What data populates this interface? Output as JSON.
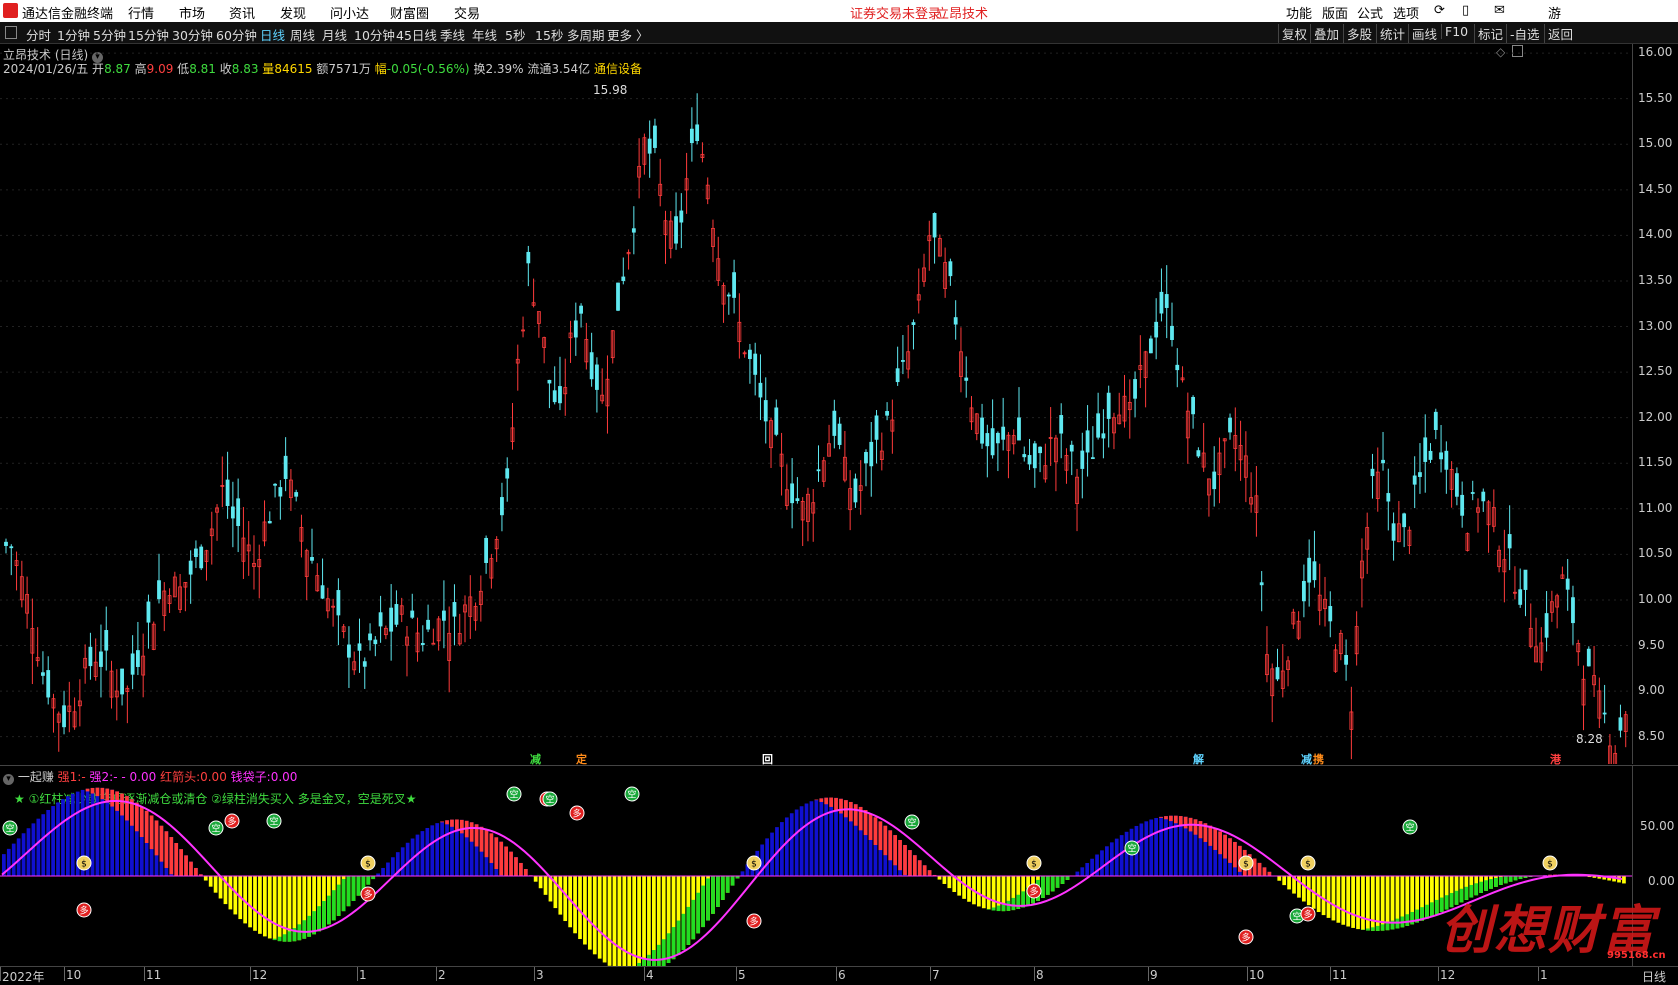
{
  "menubar": {
    "app_title": "通达信金融终端",
    "items": [
      "行情",
      "市场",
      "资讯",
      "发现",
      "问小达",
      "财富圈",
      "交易"
    ],
    "center_notice": "证券交易未登录",
    "center_product": "立昂技术",
    "right_items": [
      "功能",
      "版面",
      "公式",
      "选项"
    ],
    "right_extra": "游"
  },
  "toolbar": {
    "periods": [
      "分时",
      "1分钟",
      "5分钟",
      "15分钟",
      "30分钟",
      "60分钟",
      "日线",
      "周线",
      "月线",
      "10分钟",
      "45日线",
      "季线",
      "年线",
      "5秒",
      "15秒",
      "多周期",
      "更多 〉"
    ],
    "selected": "日线",
    "right_buttons": [
      "复权",
      "叠加",
      "多股",
      "统计",
      "画线",
      "F10",
      "标记",
      "-自选",
      "返回"
    ]
  },
  "chart_header": {
    "title": "立昂技术 (日线)",
    "date": "2024/01/26/五",
    "open_label": "开",
    "open": "8.87",
    "high_label": "高",
    "high": "9.09",
    "low_label": "低",
    "low": "8.81",
    "close_label": "收",
    "close": "8.83",
    "vol_label": "量",
    "vol": "84615",
    "amount_label": "额",
    "amount": "7571万",
    "change_label": "幅",
    "change": "-0.05(-0.56%)",
    "turnover_label": "换",
    "turnover": "2.39%",
    "float_label": "流通",
    "float": "3.54亿",
    "sector": "通信设备"
  },
  "price_axis": [
    "16.00",
    "15.50",
    "15.00",
    "14.50",
    "14.00",
    "13.50",
    "13.00",
    "12.50",
    "12.00",
    "11.50",
    "11.00",
    "10.50",
    "10.00",
    "9.50",
    "9.00",
    "8.50"
  ],
  "annotations": {
    "max_label": "15.98",
    "min_label": "8.28"
  },
  "signals": [
    {
      "text": "减",
      "color": "#3fdc3f"
    },
    {
      "text": "定",
      "color": "#ff8c1a"
    },
    {
      "text": "回",
      "color": "#ffffff"
    },
    {
      "text": "解",
      "color": "#5fd3ff"
    },
    {
      "text": "减",
      "color": "#5fd3ff"
    },
    {
      "text": "携",
      "color": "#ff8c1a"
    },
    {
      "text": "港",
      "color": "#ff4040"
    }
  ],
  "indicator": {
    "name": "一起赚",
    "v1_label": "强1:",
    "v1": "-",
    "v2_label": "强2:",
    "v2": "- - 0.00",
    "v3_label": "红箭头:",
    "v3": "0.00",
    "v4_label": "钱袋子:",
    "v4": "0.00",
    "note": "★ ①红柱减少或变短逐渐减仓或清仓 ②绿柱消失买入 多是金叉，空是死叉★",
    "axis": [
      "50.00",
      "0.00"
    ]
  },
  "markers": {
    "empty": "空",
    "multi": "多",
    "bag": "$"
  },
  "time_axis": [
    "2022年",
    "10",
    "11",
    "12",
    "1",
    "2",
    "3",
    "4",
    "5",
    "6",
    "7",
    "8",
    "9",
    "10",
    "11",
    "12",
    "1"
  ],
  "period_label": "日线",
  "watermark": {
    "text": "创想财富",
    "url": "995168.cn"
  },
  "colors": {
    "up": "#ff3b3b",
    "down": "#5fe8f0",
    "blue": "#1010d0",
    "yellow": "#ffff00",
    "green": "#22dd22",
    "magenta": "#ff33ff"
  },
  "chart_data": {
    "type": "candlestick",
    "ylim": [
      8.2,
      16.1
    ],
    "closes": [
      10.6,
      10.2,
      9.8,
      9.2,
      8.9,
      8.7,
      8.9,
      9.2,
      9.4,
      9.3,
      9.1,
      9.0,
      9.4,
      9.7,
      10.0,
      10.2,
      10.1,
      10.3,
      10.5,
      10.8,
      11.2,
      10.9,
      10.7,
      10.4,
      10.8,
      11.1,
      11.4,
      11.0,
      10.6,
      10.3,
      10.0,
      9.7,
      9.5,
      9.3,
      9.4,
      9.6,
      9.7,
      9.8,
      9.7,
      9.6,
      9.7,
      9.8,
      9.7,
      9.9,
      10.1,
      10.4,
      10.8,
      11.2,
      12.6,
      13.6,
      13.2,
      12.4,
      12.0,
      12.8,
      13.2,
      12.6,
      12.2,
      12.9,
      13.6,
      14.2,
      15.0,
      14.8,
      14.2,
      13.8,
      14.6,
      15.2,
      14.6,
      13.8,
      13.4,
      13.0,
      12.6,
      12.2,
      11.8,
      11.5,
      11.2,
      11.0,
      11.2,
      11.6,
      11.9,
      11.4,
      11.1,
      11.4,
      11.7,
      11.9,
      12.3,
      12.7,
      13.2,
      14.0,
      13.8,
      13.4,
      12.8,
      12.2,
      11.8,
      11.6,
      11.7,
      11.9,
      11.6,
      11.4,
      11.6,
      11.8,
      11.6,
      11.4,
      11.5,
      11.8,
      12.1,
      12.2,
      12.0,
      12.4,
      12.8,
      13.2,
      13.0,
      12.3,
      11.9,
      11.5,
      11.3,
      11.6,
      11.8,
      11.5,
      11.0,
      9.4,
      9.1,
      9.5,
      9.9,
      10.3,
      10.0,
      9.7,
      9.5,
      8.9,
      10.4,
      11.2,
      11.4,
      10.8,
      10.7,
      11.1,
      11.5,
      11.8,
      11.6,
      11.2,
      10.9,
      11.1,
      11.0,
      10.7,
      10.4,
      10.1,
      9.8,
      9.5,
      9.9,
      10.2,
      9.8,
      9.3,
      9.0,
      8.7,
      8.4,
      8.8
    ]
  }
}
